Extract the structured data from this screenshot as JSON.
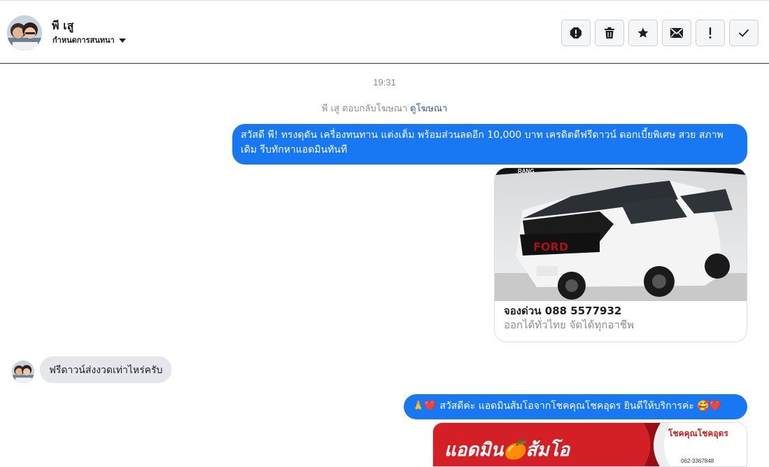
{
  "header": {
    "contact_name": "พี เสู",
    "assign_label": "กำหนดการสนทนา",
    "actions": [
      {
        "icon": "alert-circle-icon"
      },
      {
        "icon": "trash-icon"
      },
      {
        "icon": "star-icon"
      },
      {
        "icon": "envelope-icon"
      },
      {
        "icon": "exclamation-icon"
      },
      {
        "icon": "check-icon"
      }
    ]
  },
  "thread": {
    "timestamp": "19:31",
    "reply_note": "พี เสู ตอบกลับโฆษณา",
    "reply_link": "ดูโฆษณา",
    "message1": "สวัสดี พี!  ทรงดุดัน เครื่องทนทาน แต่งเต็ม พร้อมส่วนลดอีก 10,000 บาท เครดิตดีฟรีดาวน์ ดอกเบี้ยพิเศษ สวย สภาพเดิม รีบทักหาแอดมินทันที",
    "card": {
      "title": "จองด่วน 088 5577932",
      "subtitle": "ออกได้ทั่วไทย จัดได้ทุกอาชีพ"
    },
    "incoming": "ฟรีดาวน์ส่งงวดเท่าไหร่ครับ",
    "message2": "🙏❤️ สวัสดีค่ะ แอดมินส้มโอจากโชคคุณโชคอุดร ยินดีให้บริการค่ะ 🥰❤️",
    "card2": {
      "title": "แอดมิน🍊ส้มโอ",
      "brand": "โชคคุณโชคอุดร",
      "phone": "062-3367848"
    }
  },
  "colors": {
    "accent": "#1877f2",
    "incoming_bubble": "#e4e6eb",
    "muted_text": "#8a8d91",
    "link": "#385898"
  }
}
